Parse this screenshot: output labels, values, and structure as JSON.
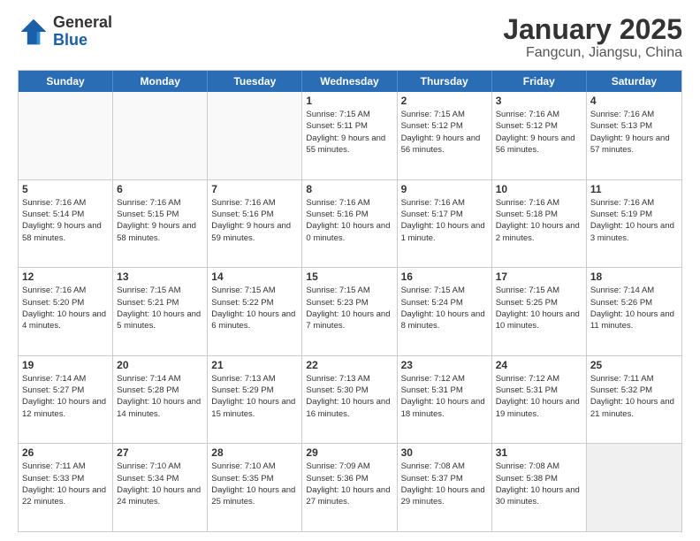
{
  "logo": {
    "general": "General",
    "blue": "Blue"
  },
  "title": "January 2025",
  "subtitle": "Fangcun, Jiangsu, China",
  "weekdays": [
    "Sunday",
    "Monday",
    "Tuesday",
    "Wednesday",
    "Thursday",
    "Friday",
    "Saturday"
  ],
  "rows": [
    [
      {
        "day": "",
        "info": ""
      },
      {
        "day": "",
        "info": ""
      },
      {
        "day": "",
        "info": ""
      },
      {
        "day": "1",
        "info": "Sunrise: 7:15 AM\nSunset: 5:11 PM\nDaylight: 9 hours\nand 55 minutes."
      },
      {
        "day": "2",
        "info": "Sunrise: 7:15 AM\nSunset: 5:12 PM\nDaylight: 9 hours\nand 56 minutes."
      },
      {
        "day": "3",
        "info": "Sunrise: 7:16 AM\nSunset: 5:12 PM\nDaylight: 9 hours\nand 56 minutes."
      },
      {
        "day": "4",
        "info": "Sunrise: 7:16 AM\nSunset: 5:13 PM\nDaylight: 9 hours\nand 57 minutes."
      }
    ],
    [
      {
        "day": "5",
        "info": "Sunrise: 7:16 AM\nSunset: 5:14 PM\nDaylight: 9 hours\nand 58 minutes."
      },
      {
        "day": "6",
        "info": "Sunrise: 7:16 AM\nSunset: 5:15 PM\nDaylight: 9 hours\nand 58 minutes."
      },
      {
        "day": "7",
        "info": "Sunrise: 7:16 AM\nSunset: 5:16 PM\nDaylight: 9 hours\nand 59 minutes."
      },
      {
        "day": "8",
        "info": "Sunrise: 7:16 AM\nSunset: 5:16 PM\nDaylight: 10 hours\nand 0 minutes."
      },
      {
        "day": "9",
        "info": "Sunrise: 7:16 AM\nSunset: 5:17 PM\nDaylight: 10 hours\nand 1 minute."
      },
      {
        "day": "10",
        "info": "Sunrise: 7:16 AM\nSunset: 5:18 PM\nDaylight: 10 hours\nand 2 minutes."
      },
      {
        "day": "11",
        "info": "Sunrise: 7:16 AM\nSunset: 5:19 PM\nDaylight: 10 hours\nand 3 minutes."
      }
    ],
    [
      {
        "day": "12",
        "info": "Sunrise: 7:16 AM\nSunset: 5:20 PM\nDaylight: 10 hours\nand 4 minutes."
      },
      {
        "day": "13",
        "info": "Sunrise: 7:15 AM\nSunset: 5:21 PM\nDaylight: 10 hours\nand 5 minutes."
      },
      {
        "day": "14",
        "info": "Sunrise: 7:15 AM\nSunset: 5:22 PM\nDaylight: 10 hours\nand 6 minutes."
      },
      {
        "day": "15",
        "info": "Sunrise: 7:15 AM\nSunset: 5:23 PM\nDaylight: 10 hours\nand 7 minutes."
      },
      {
        "day": "16",
        "info": "Sunrise: 7:15 AM\nSunset: 5:24 PM\nDaylight: 10 hours\nand 8 minutes."
      },
      {
        "day": "17",
        "info": "Sunrise: 7:15 AM\nSunset: 5:25 PM\nDaylight: 10 hours\nand 10 minutes."
      },
      {
        "day": "18",
        "info": "Sunrise: 7:14 AM\nSunset: 5:26 PM\nDaylight: 10 hours\nand 11 minutes."
      }
    ],
    [
      {
        "day": "19",
        "info": "Sunrise: 7:14 AM\nSunset: 5:27 PM\nDaylight: 10 hours\nand 12 minutes."
      },
      {
        "day": "20",
        "info": "Sunrise: 7:14 AM\nSunset: 5:28 PM\nDaylight: 10 hours\nand 14 minutes."
      },
      {
        "day": "21",
        "info": "Sunrise: 7:13 AM\nSunset: 5:29 PM\nDaylight: 10 hours\nand 15 minutes."
      },
      {
        "day": "22",
        "info": "Sunrise: 7:13 AM\nSunset: 5:30 PM\nDaylight: 10 hours\nand 16 minutes."
      },
      {
        "day": "23",
        "info": "Sunrise: 7:12 AM\nSunset: 5:31 PM\nDaylight: 10 hours\nand 18 minutes."
      },
      {
        "day": "24",
        "info": "Sunrise: 7:12 AM\nSunset: 5:31 PM\nDaylight: 10 hours\nand 19 minutes."
      },
      {
        "day": "25",
        "info": "Sunrise: 7:11 AM\nSunset: 5:32 PM\nDaylight: 10 hours\nand 21 minutes."
      }
    ],
    [
      {
        "day": "26",
        "info": "Sunrise: 7:11 AM\nSunset: 5:33 PM\nDaylight: 10 hours\nand 22 minutes."
      },
      {
        "day": "27",
        "info": "Sunrise: 7:10 AM\nSunset: 5:34 PM\nDaylight: 10 hours\nand 24 minutes."
      },
      {
        "day": "28",
        "info": "Sunrise: 7:10 AM\nSunset: 5:35 PM\nDaylight: 10 hours\nand 25 minutes."
      },
      {
        "day": "29",
        "info": "Sunrise: 7:09 AM\nSunset: 5:36 PM\nDaylight: 10 hours\nand 27 minutes."
      },
      {
        "day": "30",
        "info": "Sunrise: 7:08 AM\nSunset: 5:37 PM\nDaylight: 10 hours\nand 29 minutes."
      },
      {
        "day": "31",
        "info": "Sunrise: 7:08 AM\nSunset: 5:38 PM\nDaylight: 10 hours\nand 30 minutes."
      },
      {
        "day": "",
        "info": ""
      }
    ]
  ],
  "colors": {
    "header_bg": "#2a6db5",
    "header_text": "#ffffff",
    "shaded_bg": "#f0f0f0"
  }
}
